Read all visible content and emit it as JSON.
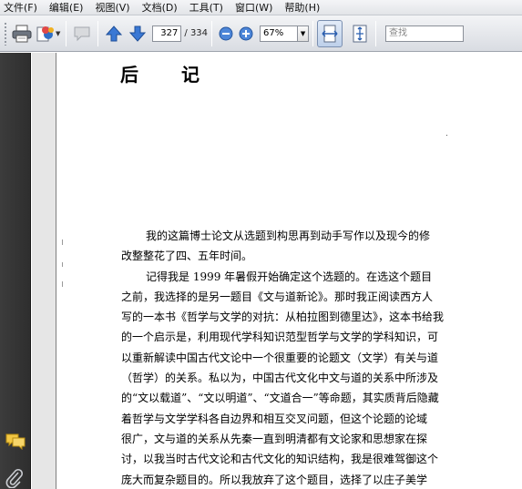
{
  "menu": [
    "文件(F)",
    "编辑(E)",
    "视图(V)",
    "文档(D)",
    "工具(T)",
    "窗口(W)",
    "帮助(H)"
  ],
  "toolbar": {
    "current_page": "327",
    "total_pages": "/ 334",
    "zoom": "67%",
    "search_placeholder": "查找"
  },
  "page": {
    "title": "后 记",
    "paragraphs": [
      {
        "lines": [
          "我的这篇博士论文从选题到构思再到动手写作以及现今的修",
          "改整整花了四、五年时间。"
        ]
      },
      {
        "lines": [
          "记得我是 1999 年暑假开始确定这个选题的。在选这个题目",
          "之前，我选择的是另一题目《文与道新论》。那时我正阅读西方人",
          "写的一本书《哲学与文学的对抗：从柏拉图到德里达》，这本书给我",
          "的一个启示是，利用现代学科知识范型哲学与文学的学科知识，可",
          "以重新解读中国古代文论中一个很重要的论题文（文学）有关与道",
          "（哲学）的关系。私以为，中国古代文化中文与道的关系中所涉及",
          "的“文以载道”、“文以明道”、“文道合一”等命题，其实质背后隐藏",
          "着哲学与文学学科各自边界和相互交叉问题，但这个论题的论域",
          "很广，文与道的关系从先秦一直到明清都有文论家和思想家在探",
          "讨，以我当时古代文论和古代文化的知识结构，我是很难驾御这个",
          "庞大而复杂题目的。所以我放弃了这个题目，选择了以庄子美学"
        ]
      }
    ]
  }
}
